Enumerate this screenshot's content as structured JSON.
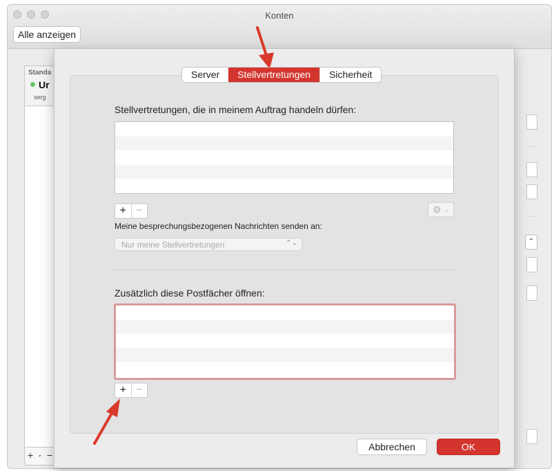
{
  "window": {
    "title": "Konten",
    "show_all_label": "Alle anzeigen"
  },
  "account_list": {
    "group_label": "Standa",
    "account_name": "Ur",
    "account_email": "serg",
    "status_color": "#66c566",
    "add_symbol": "+",
    "chevron_symbol": "⌄",
    "remove_symbol": "−"
  },
  "sheet": {
    "tabs": [
      {
        "label": "Server",
        "active": false
      },
      {
        "label": "Stellvertretungen",
        "active": true
      },
      {
        "label": "Sicherheit",
        "active": false
      }
    ],
    "delegates_label": "Stellvertretungen, die in meinem Auftrag handeln dürfen:",
    "delegates_rows": 5,
    "add_symbol": "+",
    "remove_symbol": "−",
    "gear_icon": "gear-icon",
    "meeting_label": "Meine besprechungsbezogenen Nachrichten senden an:",
    "meeting_select_value": "Nur meine Stellvertretungen",
    "mailboxes_label": "Zusätzlich diese Postfächer öffnen:",
    "mailboxes_rows": 5,
    "cancel_label": "Abbrechen",
    "ok_label": "OK"
  },
  "colors": {
    "accent": "#d3352e",
    "annotation_arrow": "#d93a2b",
    "focus_ring": "#d99a9a"
  }
}
